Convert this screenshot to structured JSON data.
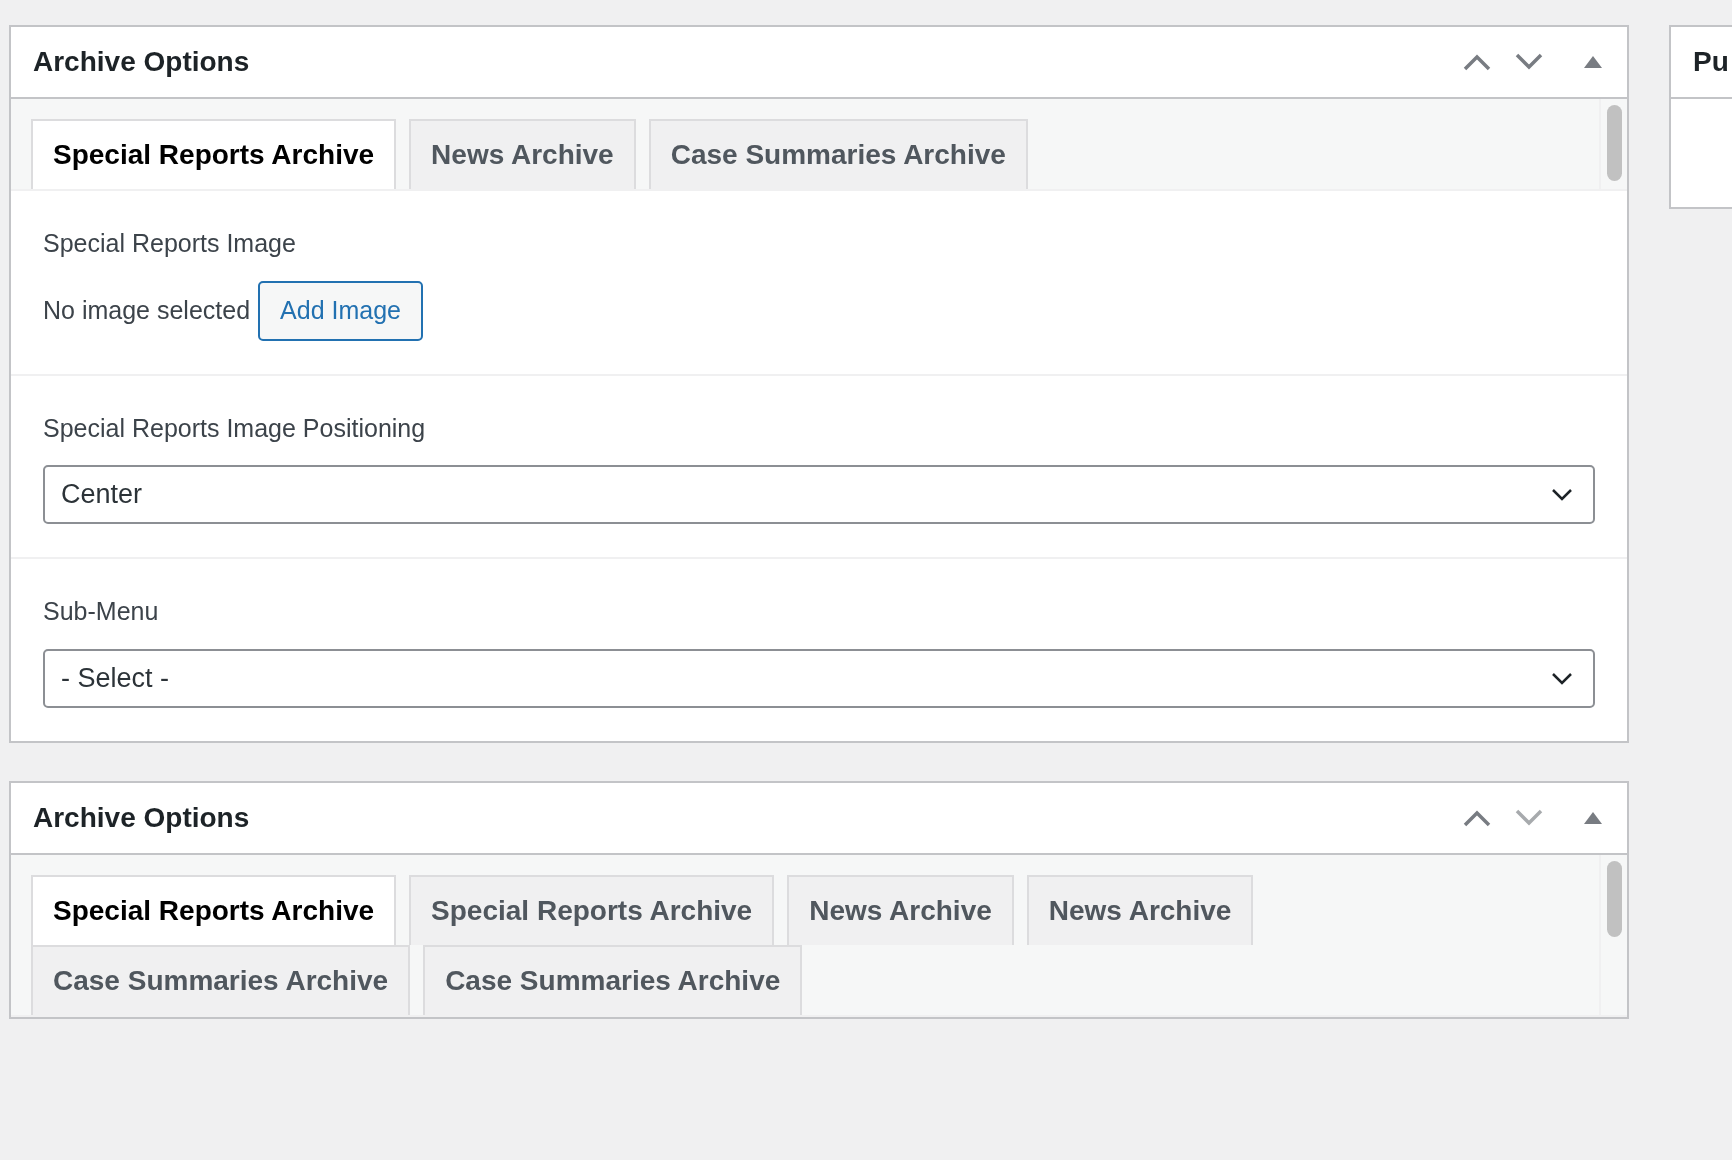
{
  "panels": [
    {
      "title": "Archive Options",
      "controls": [
        {
          "kind": "up",
          "disabled": false
        },
        {
          "kind": "down",
          "disabled": false
        },
        {
          "kind": "toggle",
          "disabled": false
        }
      ],
      "tab_rows": [
        [
          {
            "label": "Special Reports Archive",
            "selected": true
          },
          {
            "label": "News Archive",
            "selected": false
          },
          {
            "label": "Case Summaries Archive",
            "selected": false
          }
        ]
      ],
      "sections": [
        {
          "kind": "image",
          "label": "Special Reports Image",
          "status": "No image selected",
          "button": "Add Image"
        },
        {
          "kind": "select",
          "label": "Special Reports Image Positioning",
          "value": "Center"
        },
        {
          "kind": "select",
          "label": "Sub-Menu",
          "value": "- Select -"
        }
      ]
    },
    {
      "title": "Archive Options",
      "controls": [
        {
          "kind": "up",
          "disabled": false
        },
        {
          "kind": "down",
          "disabled": true
        },
        {
          "kind": "toggle",
          "disabled": false
        }
      ],
      "tab_rows": [
        [
          {
            "label": "Special Reports Archive",
            "selected": true
          },
          {
            "label": "Special Reports Archive",
            "selected": false
          },
          {
            "label": "News Archive",
            "selected": false
          },
          {
            "label": "News Archive",
            "selected": false
          }
        ],
        [
          {
            "label": "Case Summaries Archive",
            "selected": false
          },
          {
            "label": "Case Summaries Archive",
            "selected": false
          }
        ]
      ]
    }
  ],
  "side_panel": {
    "title": "Pu"
  }
}
